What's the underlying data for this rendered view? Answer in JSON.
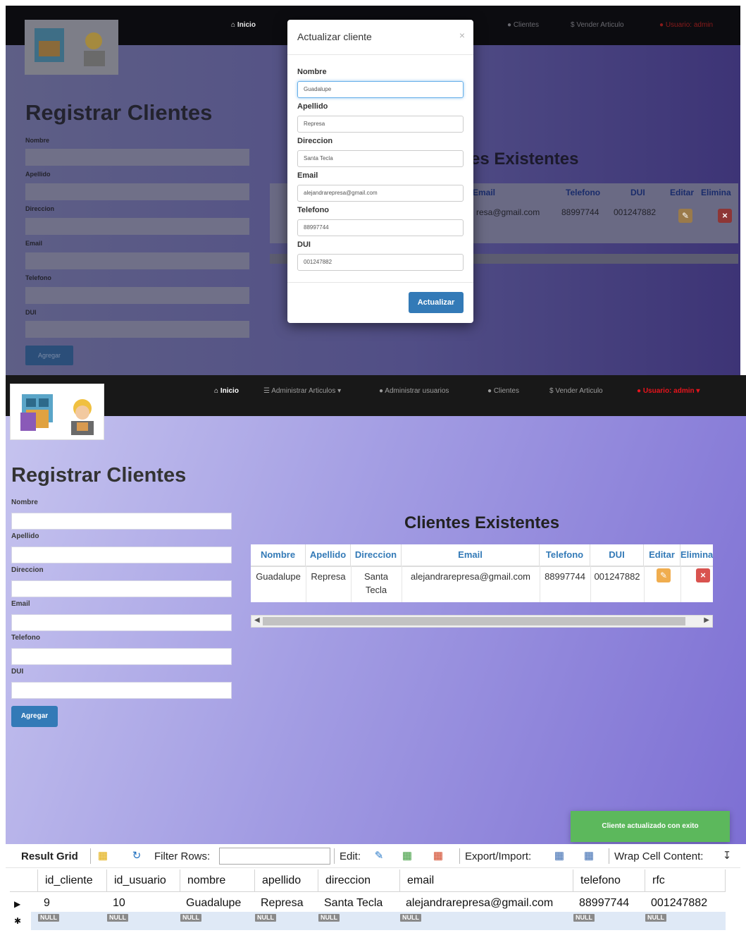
{
  "nav": {
    "home": "Inicio",
    "articles": "Administrar Articulos",
    "users": "Administrar usuarios",
    "clients": "Clientes",
    "sell": "Vender Articulo",
    "user_menu": "Usuario: admin"
  },
  "form": {
    "title": "Registrar Clientes",
    "labels": [
      "Nombre",
      "Apellido",
      "Direccion",
      "Email",
      "Telefono",
      "DUI"
    ],
    "submit": "Agregar"
  },
  "modal": {
    "title": "Actualizar cliente",
    "close": "×",
    "fields": [
      {
        "label": "Nombre",
        "value": "Guadalupe"
      },
      {
        "label": "Apellido",
        "value": "Represa"
      },
      {
        "label": "Direccion",
        "value": "Santa Tecla"
      },
      {
        "label": "Email",
        "value": "alejandrarepresa@gmail.com"
      },
      {
        "label": "Telefono",
        "value": "88997744"
      },
      {
        "label": "DUI",
        "value": "001247882"
      }
    ],
    "submit": "Actualizar"
  },
  "clients_table": {
    "title": "Clientes Existentes",
    "headers": [
      "Nombre",
      "Apellido",
      "Direccion",
      "Email",
      "Telefono",
      "DUI",
      "Editar",
      "Eliminar"
    ],
    "row": {
      "nombre": "Guadalupe",
      "apellido": "Represa",
      "direccion": "Santa Tecla",
      "email": "alejandrarepresa@gmail.com",
      "telefono": "88997744",
      "dui": "001247882"
    }
  },
  "toast": "Cliente actualizado con exito",
  "result_grid": {
    "toolbar": {
      "result_grid": "Result Grid",
      "filter_rows": "Filter Rows:",
      "edit": "Edit:",
      "export_import": "Export/Import:",
      "wrap": "Wrap Cell Content:"
    },
    "columns": [
      "id_cliente",
      "id_usuario",
      "nombre",
      "apellido",
      "direccion",
      "email",
      "telefono",
      "rfc"
    ],
    "row": [
      "9",
      "10",
      "Guadalupe",
      "Represa",
      "Santa Tecla",
      "alejandrarepresa@gmail.com",
      "88997744",
      "001247882"
    ],
    "null_label": "NULL"
  },
  "colors": {
    "navbar": "#181818",
    "primary": "#337ab7",
    "success": "#5cb85c",
    "warning": "#f0ad4e",
    "danger": "#d9534f",
    "user_red": "#e8141c"
  },
  "icons": [
    "home-icon",
    "list-icon",
    "user-icon",
    "dollar-icon",
    "pencil-icon",
    "times-icon",
    "grid-icon",
    "refresh-icon",
    "export-icon",
    "wrap-icon"
  ]
}
